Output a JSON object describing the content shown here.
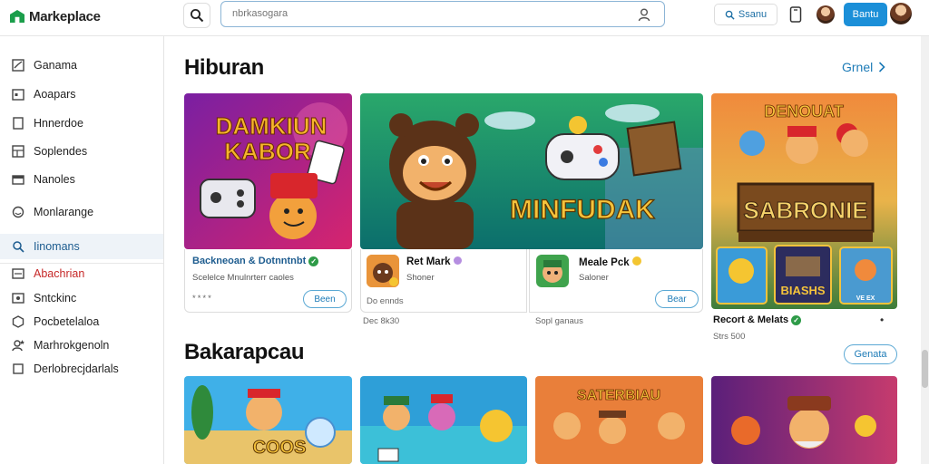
{
  "app": {
    "name": "Markeplace"
  },
  "search": {
    "placeholder": "nbrkasogara"
  },
  "topbar": {
    "search_link": "Ssanu",
    "primary_button": "Bantu"
  },
  "sidebar": {
    "items": [
      {
        "label": "Ganama",
        "icon": "chart-icon"
      },
      {
        "label": "Aoapars",
        "icon": "calendar-icon"
      },
      {
        "label": "Hnnerdoe",
        "icon": "document-icon"
      },
      {
        "label": "Soplendes",
        "icon": "grid-icon"
      },
      {
        "label": "Nanoles",
        "icon": "folder-icon"
      },
      {
        "label": "Monlarange",
        "icon": "globe-icon"
      },
      {
        "label": "Iinomans",
        "icon": "search-icon"
      },
      {
        "label": "Abachrian",
        "icon": "inbox-icon"
      },
      {
        "label": "Sntckinc",
        "icon": "box-icon"
      },
      {
        "label": "Pocbetelaloa",
        "icon": "hexagon-icon"
      },
      {
        "label": "Marhrokgenoln",
        "icon": "user-star-icon"
      },
      {
        "label": "Derlobrecjdarlals",
        "icon": "square-icon"
      }
    ]
  },
  "section1": {
    "title": "Hiburan",
    "see_all": "Grnel",
    "cards": [
      {
        "art_title": [
          "DAMKIUN",
          "KABOR"
        ],
        "title": "Backneoan & Dotnntnbt",
        "sub": "Scelelce Mnulnrterr caoles",
        "rating": "****",
        "button": "Been"
      },
      {
        "art_title": [
          "MINFUDAK"
        ],
        "app1_name": "Ret Mark",
        "app1_sub": "Shoner",
        "app1_meta": "Do ennds",
        "app1_extra": "Dec 8k30",
        "app2_name": "Meale Pck",
        "app2_sub": "Saloner",
        "app2_button": "Bear",
        "app2_extra": "Sopl ganaus"
      },
      {
        "art_title": [
          "DENOUAT",
          "SABRONIE"
        ],
        "tile_label": "BIASHS",
        "tile_badge": "VE EX",
        "title": "Recort & Melats",
        "sub": "Strs 500",
        "dot": "•"
      }
    ]
  },
  "section2": {
    "title": "Bakarapcau",
    "button": "Genata",
    "cards": [
      {
        "art_title": "COOS"
      },
      {
        "art_title": ""
      },
      {
        "art_title": "SATERBIAU"
      },
      {
        "art_title": ""
      }
    ]
  },
  "colors": {
    "accent": "#1b8fd8",
    "link": "#1d7bb7",
    "verified": "#2e9b48",
    "logo": "#1b9e4b"
  }
}
